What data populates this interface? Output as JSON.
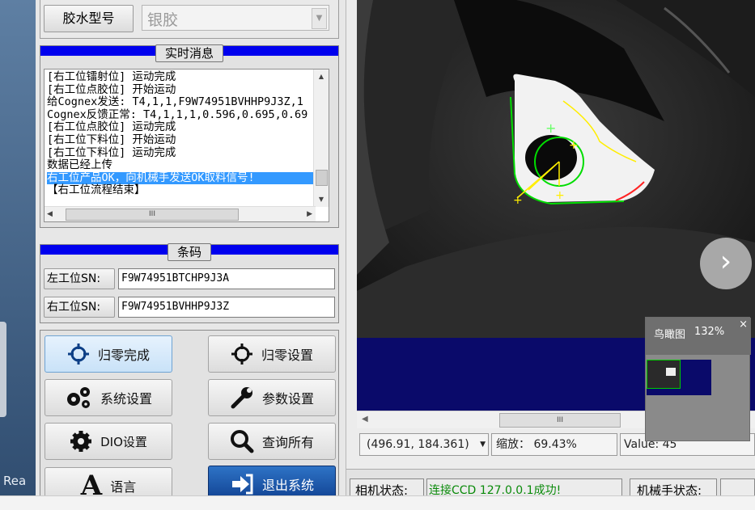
{
  "glue_type": {
    "label": "胶水型号",
    "value": "银胶"
  },
  "messages": {
    "title": "实时消息",
    "lines": [
      "[右工位镭射位] 运动完成",
      "[右工位点胶位] 开始运动",
      "给Cognex发送: T4,1,1,F9W74951BVHHP9J3Z,1",
      "Cognex反馈正常: T4,1,1,1,0.596,0.695,0.69",
      "[右工位点胶位] 运动完成",
      "[右工位下料位] 开始运动",
      "[右工位下料位] 运动完成",
      "数据已经上传",
      "右工位产品OK，向机械手发送OK取料信号!",
      "【右工位流程结束】"
    ],
    "selected_index": 8
  },
  "barcode": {
    "title": "条码",
    "left_label": "左工位SN:",
    "left_value": "F9W74951BTCHP9J3A",
    "right_label": "右工位SN:",
    "right_value": "F9W74951BVHHP9J3Z"
  },
  "buttons": {
    "home_done": "归零完成",
    "home_settings": "归零设置",
    "system_settings": "系统设置",
    "param_settings": "参数设置",
    "dio_settings": "DIO设置",
    "query_all": "查询所有",
    "language": "语言",
    "exit_system": "退出系统"
  },
  "viewer": {
    "coords": "(496.91, 184.361)",
    "zoom": "缩放： 69.43%",
    "value": "Value: 45",
    "overview_title": "鸟瞰图",
    "overview_zoom": "132%",
    "hscroll_grip": "III"
  },
  "log_hscroll_grip": "III",
  "status": {
    "camera_label": "相机状态:",
    "camera_value": "连接CCD 127.0.0.1成功!",
    "robot_label": "机械手状态:"
  },
  "left_edge_text": "Rea",
  "colors": {
    "section_blue": "#0000ee",
    "status_green": "#0a8a0a",
    "viewer_bg": "#0a0a6a",
    "selected_blue": "#3399ff"
  }
}
